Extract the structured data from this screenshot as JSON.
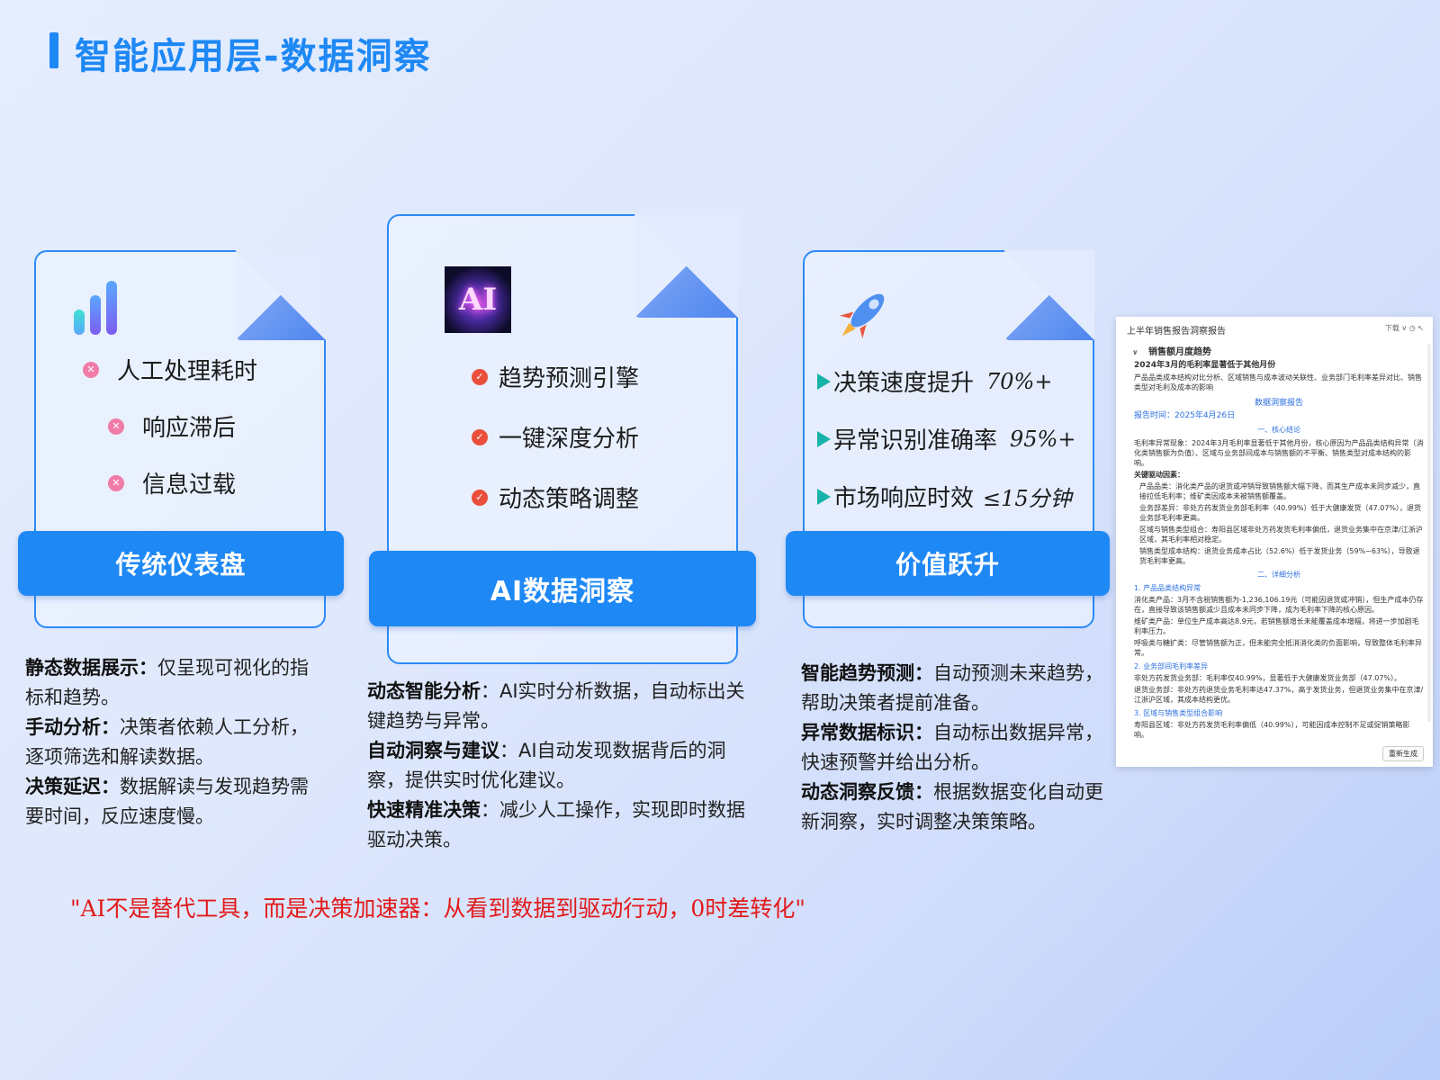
{
  "title": "智能应用层-数据洞察",
  "cards": {
    "traditional": {
      "icon": "bar-chart-icon",
      "banner": "传统仪表盘",
      "bullets": [
        "人工处理耗时",
        "响应滞后",
        "信息过载"
      ]
    },
    "ai": {
      "icon": "ai-image",
      "icon_text": "AI",
      "banner": "AI数据洞察",
      "bullets": [
        "趋势预测引擎",
        "一键深度分析",
        "动态策略调整"
      ]
    },
    "value": {
      "icon": "rocket-icon",
      "banner": "价值跃升",
      "metrics": [
        {
          "label": "决策速度提升",
          "value": "70%+"
        },
        {
          "label": "异常识别准确率",
          "value": "95%+"
        },
        {
          "label": "市场响应时效",
          "value": "≤15分钟"
        }
      ]
    }
  },
  "descriptions": {
    "traditional": [
      {
        "head": "静态数据展示：",
        "text": "仅呈现可视化的指标和趋势。"
      },
      {
        "head": "手动分析：",
        "text": "决策者依赖人工分析，逐项筛选和解读数据。"
      },
      {
        "head": "决策延迟：",
        "text": "数据解读与发现趋势需要时间，反应速度慢。"
      }
    ],
    "ai": [
      {
        "head": "动态智能分析",
        "text": "：AI实时分析数据，自动标出关键趋势与异常。"
      },
      {
        "head": "自动洞察与建议",
        "text": "：AI自动发现数据背后的洞察，提供实时优化建议。"
      },
      {
        "head": "快速精准决策",
        "text": "：减少人工操作，实现即时数据驱动决策。"
      }
    ],
    "value": [
      {
        "head": "智能趋势预测：",
        "text": "自动预测未来趋势，帮助决策者提前准备。"
      },
      {
        "head": "异常数据标识：",
        "text": "自动标出数据异常，快速预警并给出分析。"
      },
      {
        "head": "动态洞察反馈：",
        "text": "根据数据变化自动更新洞察，实时调整决策策略。"
      }
    ]
  },
  "quote": "\"AI不是替代工具，而是决策加速器：从看到数据到驱动行动，0时差转化\"",
  "report": {
    "title": "上半年销售报告洞察报告",
    "tools": "下载 ∨ ◷ ↖",
    "section": "销售额月度趋势",
    "headline": "2024年3月的毛利率显著低于其他月份",
    "intro": "产品品类成本结构对比分析、区域销售与成本波动关联性、业务部门毛利率差异对比、销售类型对毛利及成本的影响",
    "report_label": "数据洞察报告",
    "report_time": "报告时间：2025年4月26日",
    "core_title": "一、核心结论",
    "core_lines": [
      "毛利率异常现象：2024年3月毛利率显著低于其他月份，核心原因为产品品类结构异常（消化类销售额为负值）、区域与业务部间成本与销售额的不平衡、销售类型对成本结构的影响。",
      "关键驱动因素：",
      "产品品类：消化类产品的退货或冲销导致销售额大幅下降，而其生产成本未同步减少，直接拉低毛利率；维矿类因成本未被销售额覆盖。",
      "业务部差异：非处方药发货业务部毛利率（40.99%）低于大健康发货（47.07%），退货业务部毛利率更高。",
      "区域与销售类型组合：寿阳县区域非处方药发货毛利率偏低，退货业务集中在京津/江浙沪区域，其毛利率相对稳定。",
      "销售类型成本结构：退货业务成本占比（52.6%）低于发货业务（59%~63%），导致退货毛利率更高。"
    ],
    "detail_title": "二、详细分析",
    "detail_groups": [
      {
        "title": "1. 产品品类结构异常",
        "lines": [
          "消化类产品：3月不含税销售额为-1,236,106.19元（可能因退货或冲销），但生产成本仍存在，直接导致该销售额减少且成本未同步下降，成为毛利率下降的核心原因。",
          "维矿类产品：单位生产成本高达8.9元，若销售额增长未能覆盖成本增幅，将进一步加剧毛利率压力。",
          "呼吸类与糖扩类：尽管销售额为正，但未能完全抵消消化类的负面影响，导致整体毛利率异常。"
        ]
      },
      {
        "title": "2. 业务部间毛利率差异",
        "lines": [
          "非处方药发货业务部：毛利率仅40.99%，显著低于大健康发货业务部（47.07%）。",
          "退货业务部：非处方药退货业务毛利率达47.37%，高于发货业务，但退货业务集中在京津/江浙沪区域，其成本结构更优。"
        ]
      },
      {
        "title": "3. 区域与销售类型组合影响",
        "lines": [
          "寿阳县区域：非处方药发货毛利率偏低（40.99%），可能因成本控制不足或促销策略影响。"
        ]
      }
    ],
    "regen_button": "重新生成"
  }
}
